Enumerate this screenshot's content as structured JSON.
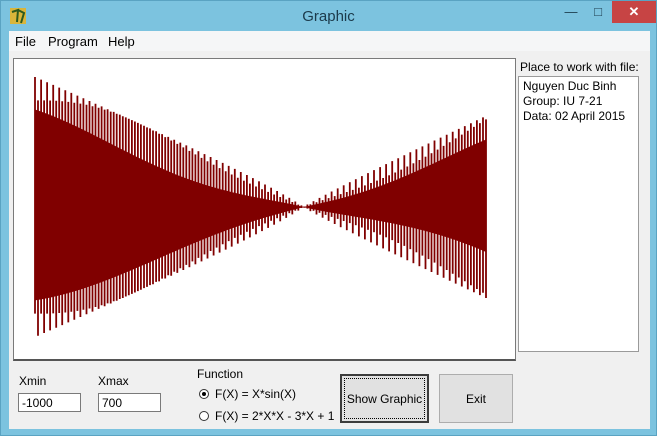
{
  "window": {
    "title": "Graphic"
  },
  "menu": {
    "file": "File",
    "program": "Program",
    "help": "Help"
  },
  "side_panel": {
    "label": "Place to work with file:",
    "memo_lines": [
      "Nguyen Duc Binh",
      "Group: IU 7-21",
      "",
      "Data: 02 April 2015"
    ]
  },
  "inputs": {
    "xmin_label": "Xmin",
    "xmin_value": "-1000",
    "xmax_label": "Xmax",
    "xmax_value": "700"
  },
  "function_group": {
    "label": "Function",
    "options": [
      "F(X) = X*sin(X)",
      "F(X) = 2*X*X - 3*X + 1"
    ],
    "selected": 0
  },
  "buttons": {
    "show_graphic": "Show Graphic",
    "exit": "Exit"
  },
  "colors": {
    "plot": "#800000",
    "title_bar": "#7cc3df",
    "close": "#c74444"
  },
  "plot": {
    "function": "x*sin(x)",
    "x_range": [
      -1000,
      700
    ]
  }
}
